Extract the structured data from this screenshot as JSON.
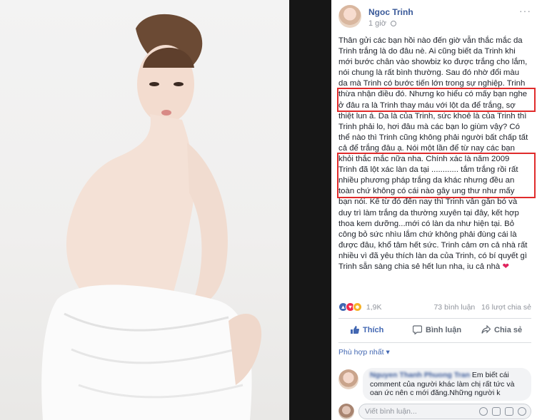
{
  "post": {
    "author": "Ngoc Trinh",
    "time": "1 giờ",
    "more": "···",
    "lines": [
      "Thân gửi các bạn hồi nào đến giờ vẫn thắc mắc da",
      "Trinh trắng là do đâu nè. Ai cũng biết da Trinh khi",
      "mới bước chân vào showbiz ko được trắng cho lắm,",
      "nói chung là rất bình thường. Sau đó nhờ đổi màu",
      "da mà Trinh có bước tiến lớn trong sự nghiệp. Trinh",
      "thừa nhận điều đó. Nhưng ko hiểu có mấy bạn nghe",
      "ở đâu ra là Trinh thay máu với lột da để trắng, sợ",
      "thiệt lun á. Da là của Trinh, sức khoẻ là của Trinh thì",
      "Trinh phải lo, hơi đâu mà các bạn lo giùm vậy? Có",
      "thể nào thì Trinh cũng không phải người bất chấp tất",
      "cả để trắng đâu ạ. Nói một lần để từ nay các bạn",
      "khỏi thắc mắc nữa nha. Chính xác là năm 2009",
      "Trinh đã lột xác làn da tại ............ tắm trắng rồi rất",
      "nhiều phương pháp trắng da khác nhưng đều an",
      "toàn chứ không có cái nào gây ung thư như mấy",
      "bạn nói. Kể từ đó đến nay thì Trinh vẫn gắn bó và",
      "duy trì làm trắng da thường xuyên tại đây, kết hợp",
      "thoa kem dưỡng...mới có làn da như hiện tại. Bỏ",
      "công bỏ sức nhìu lắm chứ không phải đùng cái là",
      "được đâu, khổ tâm hết sức. Trinh cảm ơn cả nhà rất",
      "nhiều vì đã yêu thích làn da của Trinh, có bí quyết gì",
      "Trinh sẵn sàng chia sẻ hết lun nha, iu cả nhà"
    ],
    "heart": "❤"
  },
  "reactions": {
    "count": "1,9K",
    "comments": "73 bình luận",
    "shares": "16 lượt chia sẻ"
  },
  "actions": {
    "like": "Thích",
    "comment": "Bình luận",
    "share": "Chia sẻ"
  },
  "sort_label": "Phù hợp nhất",
  "comment": {
    "name": "Nguyen Thanh Phuong Tran",
    "text_line1": "Em biết cái",
    "text_line2": "comment của người khác làm chị rất tức và",
    "text_line3": "oan ức nên c mới đăng.Những người k"
  },
  "composer": {
    "placeholder": "Viết bình luận..."
  },
  "colors": {
    "link": "#385898",
    "highlight_box": "#e02b2b",
    "like_blue": "#4267b2"
  }
}
